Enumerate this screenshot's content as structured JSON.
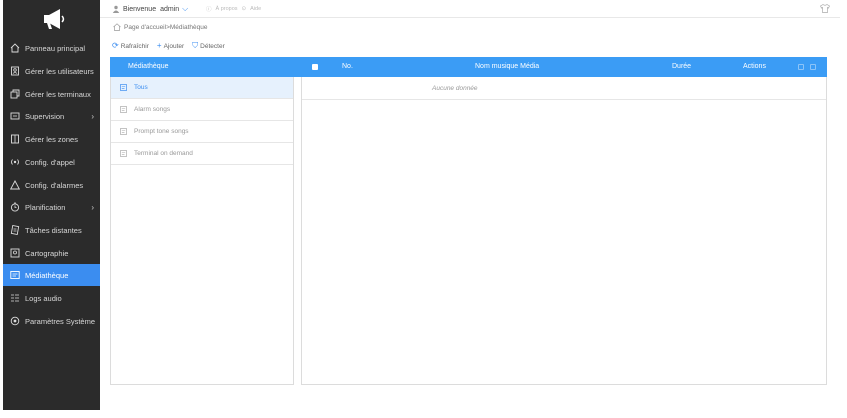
{
  "topbar": {
    "welcome": "Bienvenue",
    "user": "admin",
    "about_label": "À propos",
    "help_label": "Aide"
  },
  "sidebar": {
    "items": [
      {
        "label": "Panneau principal",
        "icon": "home-icon"
      },
      {
        "label": "Gérer les utilisateurs",
        "icon": "users-icon"
      },
      {
        "label": "Gérer les terminaux",
        "icon": "terminals-icon"
      },
      {
        "label": "Supervision",
        "icon": "monitor-icon",
        "has_submenu": true
      },
      {
        "label": "Gérer les zones",
        "icon": "zones-icon"
      },
      {
        "label": "Config. d'appel",
        "icon": "broadcast-icon"
      },
      {
        "label": "Config. d'alarmes",
        "icon": "alarm-icon"
      },
      {
        "label": "Planification",
        "icon": "clock-icon",
        "has_submenu": true
      },
      {
        "label": "Tâches distantes",
        "icon": "remote-task-icon"
      },
      {
        "label": "Cartographie",
        "icon": "map-icon"
      },
      {
        "label": "Médiathèque",
        "icon": "media-library-icon",
        "active": true
      },
      {
        "label": "Logs audio",
        "icon": "audio-logs-icon"
      },
      {
        "label": "Paramètres Système",
        "icon": "settings-icon"
      }
    ]
  },
  "breadcrumb": {
    "text": "Page d'accueil>Médiathèque"
  },
  "toolbar": {
    "refresh_label": "Rafraîchir",
    "add_label": "Ajouter",
    "detect_label": "Détecter"
  },
  "table": {
    "library_header": "Médiathèque",
    "columns": {
      "no": "No.",
      "name": "Nom musique Média",
      "duration": "Durée",
      "actions": "Actions"
    },
    "empty_text": "Aucune donnée"
  },
  "library": {
    "items": [
      {
        "label": "Tous",
        "active": true
      },
      {
        "label": "Alarm songs"
      },
      {
        "label": "Prompt tone songs"
      },
      {
        "label": "Terminal on demand"
      }
    ]
  },
  "colors": {
    "accent": "#3b8df0",
    "header": "#3b9cf5",
    "sidebar": "#2b2b2b"
  }
}
